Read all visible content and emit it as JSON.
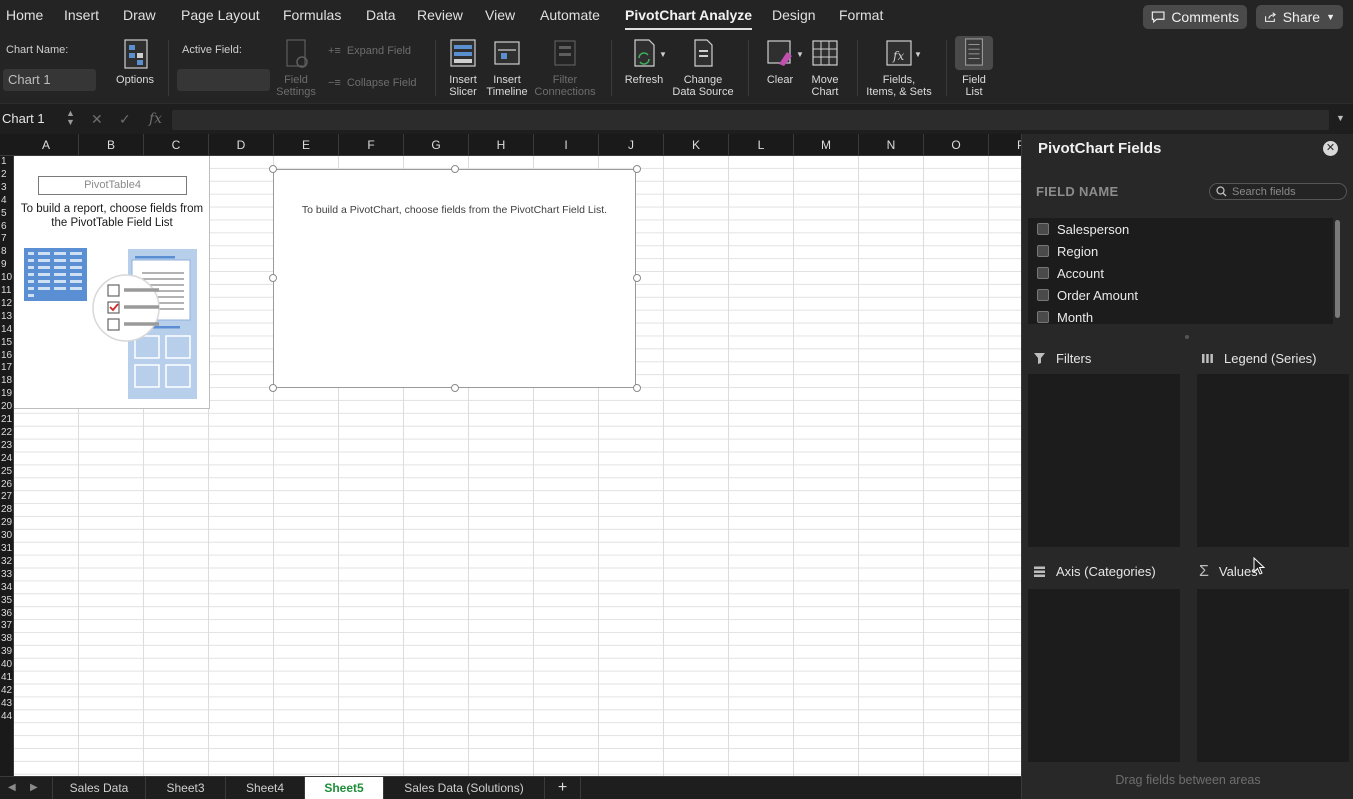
{
  "menu": {
    "tabs": [
      "Home",
      "Insert",
      "Draw",
      "Page Layout",
      "Formulas",
      "Data",
      "Review",
      "View",
      "Automate",
      "PivotChart Analyze",
      "Design",
      "Format"
    ],
    "active_tab": "PivotChart Analyze",
    "comments_label": "Comments",
    "share_label": "Share"
  },
  "ribbon": {
    "chart_name_label": "Chart Name:",
    "chart_name_value": "Chart 1",
    "options_label": "Options",
    "active_field_label": "Active Field:",
    "active_field_value": "",
    "field_settings_label": "Field\nSettings",
    "expand_field_label": "Expand Field",
    "collapse_field_label": "Collapse Field",
    "insert_slicer_label": "Insert\nSlicer",
    "insert_timeline_label": "Insert\nTimeline",
    "filter_connections_label": "Filter\nConnections",
    "refresh_label": "Refresh",
    "change_data_source_label": "Change\nData Source",
    "clear_label": "Clear",
    "move_chart_label": "Move\nChart",
    "fields_items_sets_label": "Fields,\nItems, & Sets",
    "field_list_label": "Field\nList"
  },
  "formula_bar": {
    "name_box": "Chart 1",
    "cancel_icon": "x-icon",
    "enter_icon": "check-icon",
    "fx_label": "fx",
    "formula": ""
  },
  "grid": {
    "columns": [
      "A",
      "B",
      "C",
      "D",
      "E",
      "F",
      "G",
      "H",
      "I",
      "J",
      "K",
      "L",
      "M",
      "N",
      "O",
      "P"
    ],
    "rows": [
      "1",
      "2",
      "3",
      "4",
      "5",
      "6",
      "7",
      "8",
      "9",
      "10",
      "11",
      "12",
      "13",
      "14",
      "15",
      "16",
      "17",
      "18",
      "19",
      "20",
      "21",
      "22",
      "23",
      "24",
      "25",
      "26",
      "27",
      "28",
      "29",
      "30",
      "31",
      "32",
      "33",
      "34",
      "35",
      "36",
      "37",
      "38",
      "39",
      "40",
      "41",
      "42",
      "43",
      "44"
    ]
  },
  "pivot_placeholder": {
    "name": "PivotTable4",
    "message": "To build a report, choose fields from the PivotTable Field List"
  },
  "chart_placeholder": {
    "message": "To build a PivotChart, choose fields from the PivotChart Field List."
  },
  "sheet_tabs": {
    "tabs": [
      "Sales Data",
      "Sheet3",
      "Sheet4",
      "Sheet5",
      "Sales Data (Solutions)"
    ],
    "active": "Sheet5",
    "add_label": "+"
  },
  "pane": {
    "title": "PivotChart Fields",
    "field_name_header": "FIELD NAME",
    "search_placeholder": "Search fields",
    "fields": [
      "Salesperson",
      "Region",
      "Account",
      "Order Amount",
      "Month"
    ],
    "areas": {
      "filters": "Filters",
      "legend": "Legend (Series)",
      "axis": "Axis (Categories)",
      "values": "Values"
    },
    "drag_hint": "Drag fields between areas"
  },
  "colors": {
    "active_sheet_text": "#1f8f3a",
    "pane_bg": "#282828",
    "ribbon_bg": "#242424"
  }
}
